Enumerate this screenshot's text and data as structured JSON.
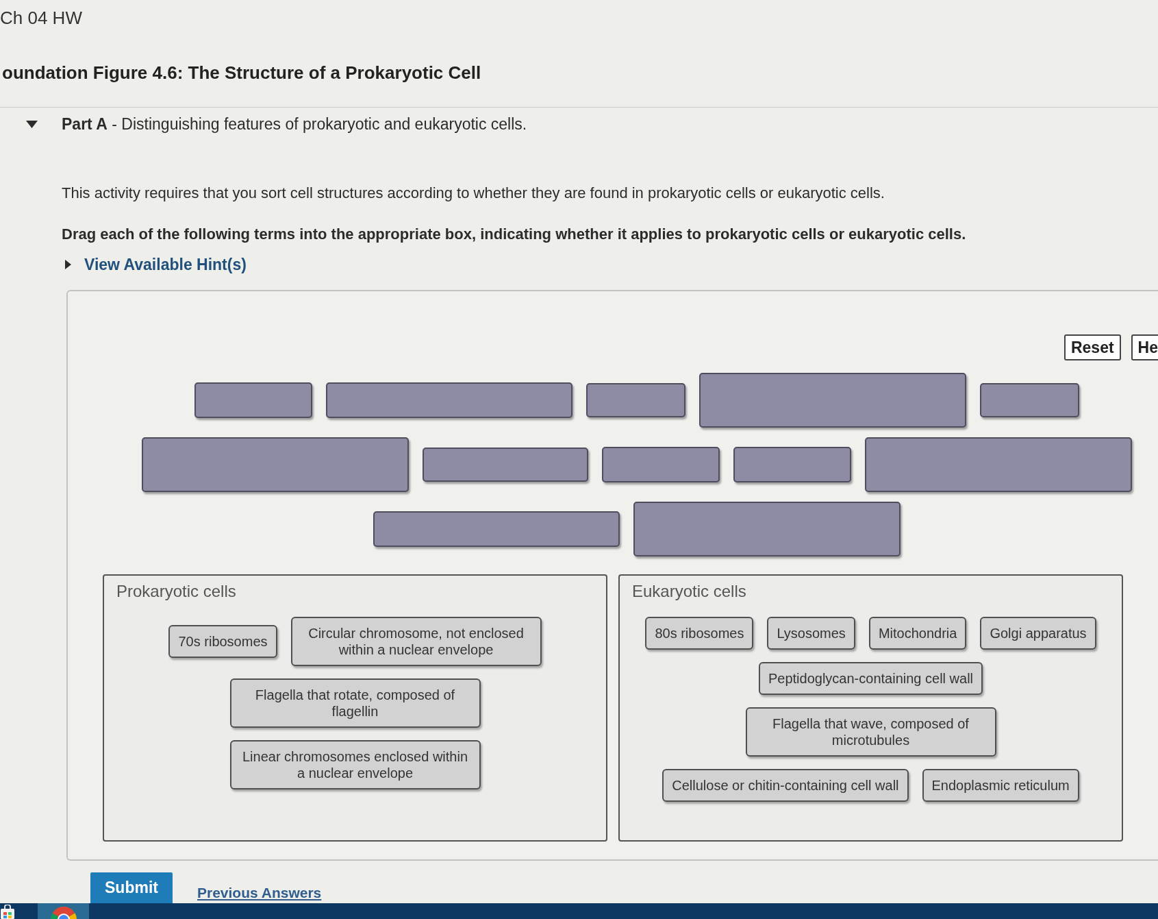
{
  "breadcrumb": "Ch 04 HW",
  "title": "oundation Figure 4.6: The Structure of a Prokaryotic Cell",
  "part": {
    "expanded": true,
    "heading": "**Part A** - Distinguishing features of prokaryotic and eukaryotic cells."
  },
  "instructions": [
    {
      "kind": "statement",
      "text": "This activity requires that you sort cell structures according to whether they are found in prokaryotic cells or eukaryotic cells."
    },
    {
      "kind": "directive",
      "text": "Drag each of the following terms into the appropriate box, indicating whether it applies to prokaryotic cells or eukaryotic cells."
    }
  ],
  "hints": {
    "expanded": false,
    "label": "View Available Hint(s)"
  },
  "activity": {
    "buttons": [
      "Reset",
      "He"
    ],
    "slot_rows": [
      {
        "slots": [
          {
            "kind": "short"
          },
          {
            "kind": "wide"
          },
          {
            "kind": "narrow"
          },
          {
            "kind": "tall"
          },
          {
            "kind": "narrow"
          }
        ]
      },
      {
        "slots": [
          {
            "kind": "tall"
          },
          {
            "kind": "medium"
          },
          {
            "kind": "short"
          },
          {
            "kind": "short"
          },
          {
            "kind": "tall"
          }
        ]
      },
      {
        "slots": [
          {
            "kind": "wide"
          },
          {
            "kind": "tall"
          }
        ]
      }
    ],
    "bins": [
      {
        "title": "Prokaryotic cells",
        "terms": [
          "70s ribosomes",
          "Circular chromosome, not enclosed within a nuclear envelope",
          "Flagella that rotate, composed of flagellin",
          "Linear chromosomes enclosed within a nuclear envelope"
        ]
      },
      {
        "title": "Eukaryotic cells",
        "terms": [
          "80s ribosomes",
          "Lysosomes",
          "Mitochondria",
          "Golgi apparatus",
          "Peptidoglycan-containing cell wall",
          "Flagella that wave, composed of microtubules",
          "Cellulose or chitin-containing cell wall",
          "Endoplasmic reticulum"
        ]
      }
    ]
  },
  "footer": {
    "submit": "Submit",
    "link": "Previous Answers"
  },
  "taskbar": {
    "apps": [
      {
        "kind": "store",
        "selected": false
      },
      {
        "kind": "browser",
        "selected": true
      }
    ]
  }
}
